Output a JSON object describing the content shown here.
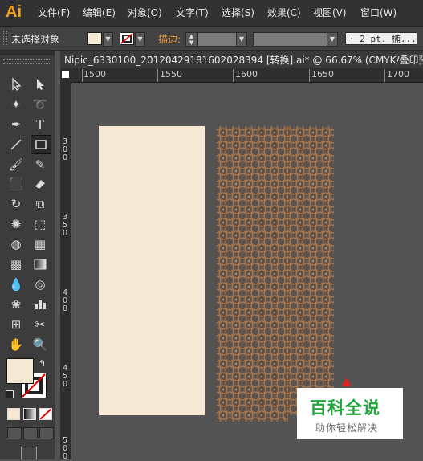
{
  "app": {
    "logo": "Ai"
  },
  "menus": [
    "文件(F)",
    "编辑(E)",
    "对象(O)",
    "文字(T)",
    "选择(S)",
    "效果(C)",
    "视图(V)",
    "窗口(W)"
  ],
  "control_bar": {
    "selection_status": "未选择对象",
    "fill_color": "#f5e9d4",
    "stroke_label": "描边:",
    "stroke_profile": "· 2 pt. 椭..."
  },
  "document": {
    "tab_title": "Nipic_6330100_20120429181602028394 [转换].ai* @ 66.67% (CMYK/叠印预"
  },
  "ruler": {
    "horizontal_labels": [
      "1500",
      "1550",
      "1600",
      "1650",
      "1700"
    ],
    "vertical_labels": [
      "300",
      "350",
      "400",
      "450",
      "500"
    ]
  },
  "canvas": {
    "rect_fill": "#f5e9d4",
    "pattern_color": "#b07a4a",
    "pattern_bg": "#6a5a52"
  },
  "watermark": {
    "title": "百科全说",
    "subtitle": "助你轻松解决"
  }
}
